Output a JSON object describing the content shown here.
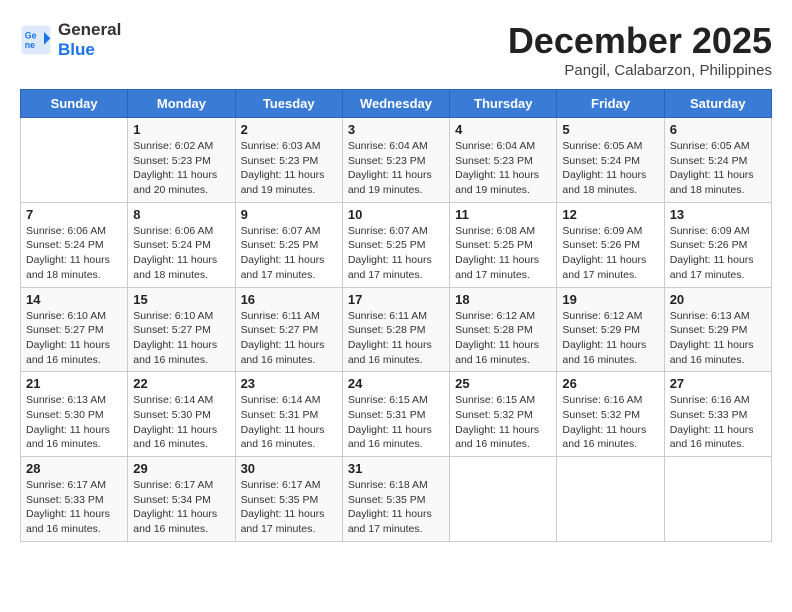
{
  "logo": {
    "line1": "General",
    "line2": "Blue"
  },
  "title": "December 2025",
  "location": "Pangil, Calabarzon, Philippines",
  "days_header": [
    "Sunday",
    "Monday",
    "Tuesday",
    "Wednesday",
    "Thursday",
    "Friday",
    "Saturday"
  ],
  "weeks": [
    [
      {
        "num": "",
        "info": ""
      },
      {
        "num": "1",
        "info": "Sunrise: 6:02 AM\nSunset: 5:23 PM\nDaylight: 11 hours\nand 20 minutes."
      },
      {
        "num": "2",
        "info": "Sunrise: 6:03 AM\nSunset: 5:23 PM\nDaylight: 11 hours\nand 19 minutes."
      },
      {
        "num": "3",
        "info": "Sunrise: 6:04 AM\nSunset: 5:23 PM\nDaylight: 11 hours\nand 19 minutes."
      },
      {
        "num": "4",
        "info": "Sunrise: 6:04 AM\nSunset: 5:23 PM\nDaylight: 11 hours\nand 19 minutes."
      },
      {
        "num": "5",
        "info": "Sunrise: 6:05 AM\nSunset: 5:24 PM\nDaylight: 11 hours\nand 18 minutes."
      },
      {
        "num": "6",
        "info": "Sunrise: 6:05 AM\nSunset: 5:24 PM\nDaylight: 11 hours\nand 18 minutes."
      }
    ],
    [
      {
        "num": "7",
        "info": "Sunrise: 6:06 AM\nSunset: 5:24 PM\nDaylight: 11 hours\nand 18 minutes."
      },
      {
        "num": "8",
        "info": "Sunrise: 6:06 AM\nSunset: 5:24 PM\nDaylight: 11 hours\nand 18 minutes."
      },
      {
        "num": "9",
        "info": "Sunrise: 6:07 AM\nSunset: 5:25 PM\nDaylight: 11 hours\nand 17 minutes."
      },
      {
        "num": "10",
        "info": "Sunrise: 6:07 AM\nSunset: 5:25 PM\nDaylight: 11 hours\nand 17 minutes."
      },
      {
        "num": "11",
        "info": "Sunrise: 6:08 AM\nSunset: 5:25 PM\nDaylight: 11 hours\nand 17 minutes."
      },
      {
        "num": "12",
        "info": "Sunrise: 6:09 AM\nSunset: 5:26 PM\nDaylight: 11 hours\nand 17 minutes."
      },
      {
        "num": "13",
        "info": "Sunrise: 6:09 AM\nSunset: 5:26 PM\nDaylight: 11 hours\nand 17 minutes."
      }
    ],
    [
      {
        "num": "14",
        "info": "Sunrise: 6:10 AM\nSunset: 5:27 PM\nDaylight: 11 hours\nand 16 minutes."
      },
      {
        "num": "15",
        "info": "Sunrise: 6:10 AM\nSunset: 5:27 PM\nDaylight: 11 hours\nand 16 minutes."
      },
      {
        "num": "16",
        "info": "Sunrise: 6:11 AM\nSunset: 5:27 PM\nDaylight: 11 hours\nand 16 minutes."
      },
      {
        "num": "17",
        "info": "Sunrise: 6:11 AM\nSunset: 5:28 PM\nDaylight: 11 hours\nand 16 minutes."
      },
      {
        "num": "18",
        "info": "Sunrise: 6:12 AM\nSunset: 5:28 PM\nDaylight: 11 hours\nand 16 minutes."
      },
      {
        "num": "19",
        "info": "Sunrise: 6:12 AM\nSunset: 5:29 PM\nDaylight: 11 hours\nand 16 minutes."
      },
      {
        "num": "20",
        "info": "Sunrise: 6:13 AM\nSunset: 5:29 PM\nDaylight: 11 hours\nand 16 minutes."
      }
    ],
    [
      {
        "num": "21",
        "info": "Sunrise: 6:13 AM\nSunset: 5:30 PM\nDaylight: 11 hours\nand 16 minutes."
      },
      {
        "num": "22",
        "info": "Sunrise: 6:14 AM\nSunset: 5:30 PM\nDaylight: 11 hours\nand 16 minutes."
      },
      {
        "num": "23",
        "info": "Sunrise: 6:14 AM\nSunset: 5:31 PM\nDaylight: 11 hours\nand 16 minutes."
      },
      {
        "num": "24",
        "info": "Sunrise: 6:15 AM\nSunset: 5:31 PM\nDaylight: 11 hours\nand 16 minutes."
      },
      {
        "num": "25",
        "info": "Sunrise: 6:15 AM\nSunset: 5:32 PM\nDaylight: 11 hours\nand 16 minutes."
      },
      {
        "num": "26",
        "info": "Sunrise: 6:16 AM\nSunset: 5:32 PM\nDaylight: 11 hours\nand 16 minutes."
      },
      {
        "num": "27",
        "info": "Sunrise: 6:16 AM\nSunset: 5:33 PM\nDaylight: 11 hours\nand 16 minutes."
      }
    ],
    [
      {
        "num": "28",
        "info": "Sunrise: 6:17 AM\nSunset: 5:33 PM\nDaylight: 11 hours\nand 16 minutes."
      },
      {
        "num": "29",
        "info": "Sunrise: 6:17 AM\nSunset: 5:34 PM\nDaylight: 11 hours\nand 16 minutes."
      },
      {
        "num": "30",
        "info": "Sunrise: 6:17 AM\nSunset: 5:35 PM\nDaylight: 11 hours\nand 17 minutes."
      },
      {
        "num": "31",
        "info": "Sunrise: 6:18 AM\nSunset: 5:35 PM\nDaylight: 11 hours\nand 17 minutes."
      },
      {
        "num": "",
        "info": ""
      },
      {
        "num": "",
        "info": ""
      },
      {
        "num": "",
        "info": ""
      }
    ]
  ]
}
